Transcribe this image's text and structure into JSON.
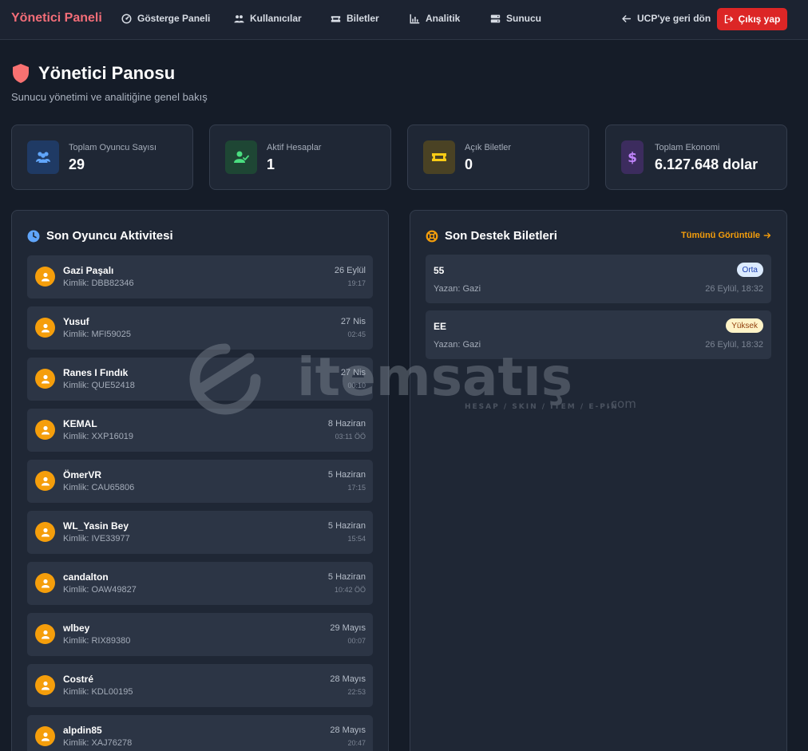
{
  "nav": {
    "brand": "Yönetici Paneli",
    "items": [
      {
        "label": "Gösterge Paneli",
        "icon": "dashboard-icon"
      },
      {
        "label": "Kullanıcılar",
        "icon": "users-icon"
      },
      {
        "label": "Biletler",
        "icon": "ticket-icon"
      },
      {
        "label": "Analitik",
        "icon": "chart-icon"
      },
      {
        "label": "Sunucu",
        "icon": "server-icon"
      }
    ],
    "back_label": "UCP'ye geri dön",
    "logout_label": "Çıkış yap"
  },
  "header": {
    "title": "Yönetici Panosu",
    "subtitle": "Sunucu yönetimi ve analitiğine genel bakış"
  },
  "stats": [
    {
      "label": "Toplam Oyuncu Sayısı",
      "value": "29",
      "color": "#60a5fa"
    },
    {
      "label": "Aktif Hesaplar",
      "value": "1",
      "color": "#4ade80"
    },
    {
      "label": "Açık Biletler",
      "value": "0",
      "color": "#facc15"
    },
    {
      "label": "Toplam Ekonomi",
      "value": "6.127.648 dolar",
      "color": "#c084fc"
    }
  ],
  "activity": {
    "title": "Son Oyuncu Aktivitesi",
    "items": [
      {
        "name": "Gazi Paşalı",
        "id": "Kimlik: DBB82346",
        "date": "26 Eylül",
        "time": "19:17"
      },
      {
        "name": "Yusuf",
        "id": "Kimlik: MFI59025",
        "date": "27 Nis",
        "time": "02:45"
      },
      {
        "name": "Ranes I Fındık",
        "id": "Kimlik: QUE52418",
        "date": "27 Nis",
        "time": "00:10"
      },
      {
        "name": "KEMAL",
        "id": "Kimlik: XXP16019",
        "date": "8 Haziran",
        "time": "03:11 ÖÖ"
      },
      {
        "name": "ÖmerVR",
        "id": "Kimlik: CAU65806",
        "date": "5 Haziran",
        "time": "17:15"
      },
      {
        "name": "WL_Yasin Bey",
        "id": "Kimlik: IVE33977",
        "date": "5 Haziran",
        "time": "15:54"
      },
      {
        "name": "candalton",
        "id": "Kimlik: OAW49827",
        "date": "5 Haziran",
        "time": "10:42 ÖÖ"
      },
      {
        "name": "wlbey",
        "id": "Kimlik: RIX89380",
        "date": "29 Mayıs",
        "time": "00:07"
      },
      {
        "name": "Costré",
        "id": "Kimlik: KDL00195",
        "date": "28 Mayıs",
        "time": "22:53"
      },
      {
        "name": "alpdin85",
        "id": "Kimlik: XAJ76278",
        "date": "28 Mayıs",
        "time": "20:47"
      }
    ]
  },
  "tickets": {
    "title": "Son Destek Biletleri",
    "view_all": "Tümünü Görüntüle",
    "items": [
      {
        "title": "55",
        "author": "Yazan: Gazi",
        "date": "26 Eylül, 18:32",
        "priority": "Orta",
        "badge_bg": "#dbeafe",
        "badge_fg": "#1e40af"
      },
      {
        "title": "EE",
        "author": "Yazan: Gazi",
        "date": "26 Eylül, 18:32",
        "priority": "Yüksek",
        "badge_bg": "#fef3c7",
        "badge_fg": "#92400e"
      }
    ]
  },
  "watermark": {
    "brand": "itemsatış",
    "tagline": "HESAP / SKIN / ITEM / E-PIN",
    "suffix": ".com"
  }
}
